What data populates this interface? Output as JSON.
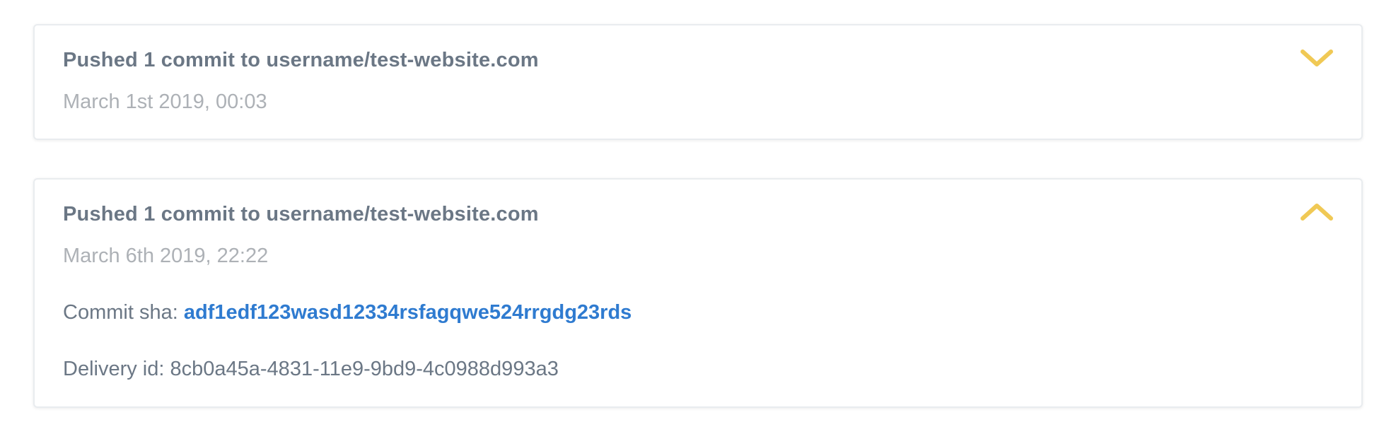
{
  "accent_color": "#f0c955",
  "link_color": "#2f7bd0",
  "events": [
    {
      "title": "Pushed 1 commit to username/test-website.com",
      "date": "March 1st 2019, 00:03",
      "expanded": false,
      "toggle_icon": "chevron-down-icon"
    },
    {
      "title": "Pushed 1 commit to username/test-website.com",
      "date": "March 6th 2019, 22:22",
      "expanded": true,
      "toggle_icon": "chevron-up-icon",
      "details": {
        "commit_sha_label": "Commit sha:",
        "commit_sha": "adf1edf123wasd12334rsfagqwe524rrgdg23rds",
        "delivery_id_label": "Delivery id:",
        "delivery_id": "8cb0a45a-4831-11e9-9bd9-4c0988d993a3"
      }
    }
  ]
}
